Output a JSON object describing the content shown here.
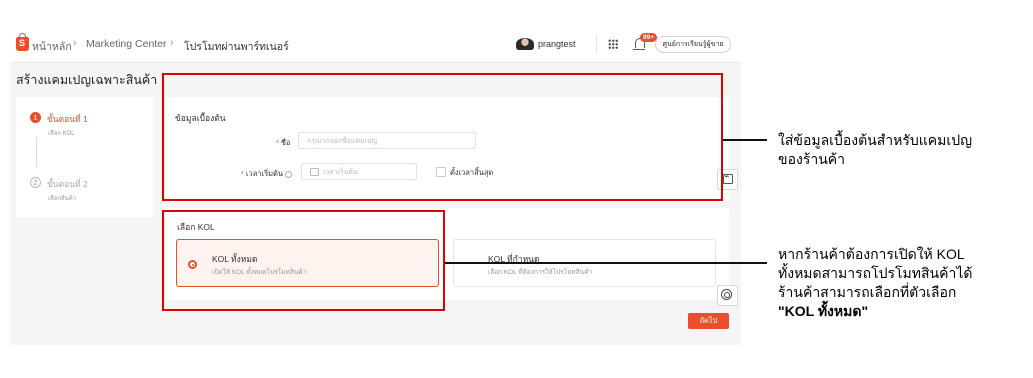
{
  "topbar": {
    "breadcrumb": [
      "หน้าหลัก",
      "Marketing Center",
      "โปรโมทผ่านพาร์ทเนอร์"
    ],
    "username": "prangtest",
    "notification_badge": "99+",
    "help_button": "ศูนย์การเรียนรู้ผู้ขาย"
  },
  "page": {
    "title": "สร้างแคมเปญเฉพาะสินค้า"
  },
  "stepper": {
    "steps": [
      {
        "number": "1",
        "title": "ขั้นตอนที่ 1",
        "subtitle": "เลือก KOL"
      },
      {
        "number": "2",
        "title": "ขั้นตอนที่ 2",
        "subtitle": "เลือกสินค้า"
      }
    ]
  },
  "basic_info": {
    "title": "ข้อมูลเบื้องต้น",
    "name_label": "ชื่อ",
    "name_placeholder": "กรุณากรอกชื่อแคมเปญ",
    "start_label": "เวลาเริ่มต้น",
    "start_placeholder": "เวลาเริ่มต้น",
    "end_checkbox_label": "ตั้งเวลาสิ้นสุด"
  },
  "kol": {
    "title": "เลือก KOL",
    "options": [
      {
        "title": "KOL ทั้งหมด",
        "desc": "เปิดให้ KOL ทั้งหมดโปรโมทสินค้า",
        "selected": true
      },
      {
        "title": "KOL ที่กำหนด",
        "desc": "เลือก KOL ที่ต้องการให้โปรโมทสินค้า",
        "selected": false
      }
    ]
  },
  "next_button": "ถัดไป",
  "annotations": {
    "note1": [
      "ใส่ข้อมูลเบื้องต้นสำหรับแคมเปญ",
      "ของร้านค้า"
    ],
    "note2": [
      "หากร้านค้าต้องการเปิดให้ KOL",
      "ทั้งหมดสามารถโปรโมทสินค้าได้",
      "ร้านค้าสามารถเลือกที่ตัวเลือก",
      "\"KOL ทั้งหมด\""
    ]
  },
  "colors": {
    "accent": "#ee4d2d",
    "highlight": "#e00000"
  }
}
